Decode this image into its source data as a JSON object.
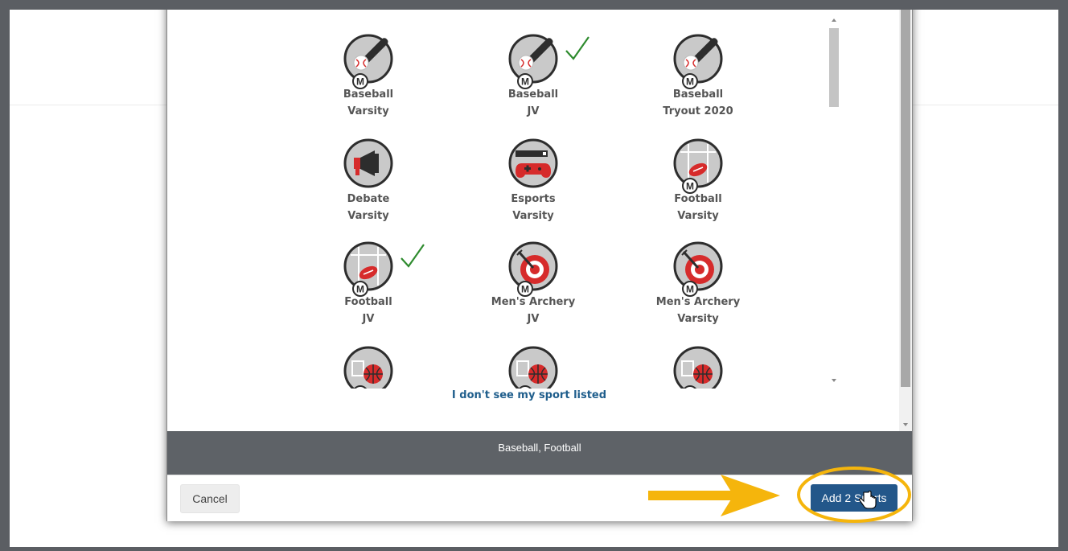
{
  "sports": [
    {
      "name": "Baseball",
      "level": "Varsity",
      "icon": "baseball-icon",
      "selected": false
    },
    {
      "name": "Baseball",
      "level": "JV",
      "icon": "baseball-icon",
      "selected": true
    },
    {
      "name": "Baseball",
      "level": "Tryout 2020",
      "icon": "baseball-icon",
      "selected": false
    },
    {
      "name": "Debate",
      "level": "Varsity",
      "icon": "megaphone-icon",
      "selected": false
    },
    {
      "name": "Esports",
      "level": "Varsity",
      "icon": "gamepad-icon",
      "selected": false
    },
    {
      "name": "Football",
      "level": "Varsity",
      "icon": "football-icon",
      "selected": false
    },
    {
      "name": "Football",
      "level": "JV",
      "icon": "football-icon",
      "selected": true
    },
    {
      "name": "Men's Archery",
      "level": "JV",
      "icon": "archery-icon",
      "selected": false
    },
    {
      "name": "Men's Archery",
      "level": "Varsity",
      "icon": "archery-icon",
      "selected": false
    },
    {
      "name": "",
      "level": "",
      "icon": "basketball-icon",
      "selected": false
    },
    {
      "name": "",
      "level": "",
      "icon": "basketball-icon",
      "selected": false
    },
    {
      "name": "",
      "level": "",
      "icon": "basketball-icon",
      "selected": false
    }
  ],
  "badge_letter": "M",
  "link_text": "I don't see my sport listed",
  "selection_summary": "Baseball, Football",
  "footer": {
    "cancel_label": "Cancel",
    "add_label": "Add 2 Sports"
  },
  "colors": {
    "accent_red": "#d62b2b",
    "icon_gray": "#c9c9c9",
    "check_green": "#2e8b2e",
    "primary_button": "#23578a",
    "annotation_yellow": "#f5b50c"
  }
}
